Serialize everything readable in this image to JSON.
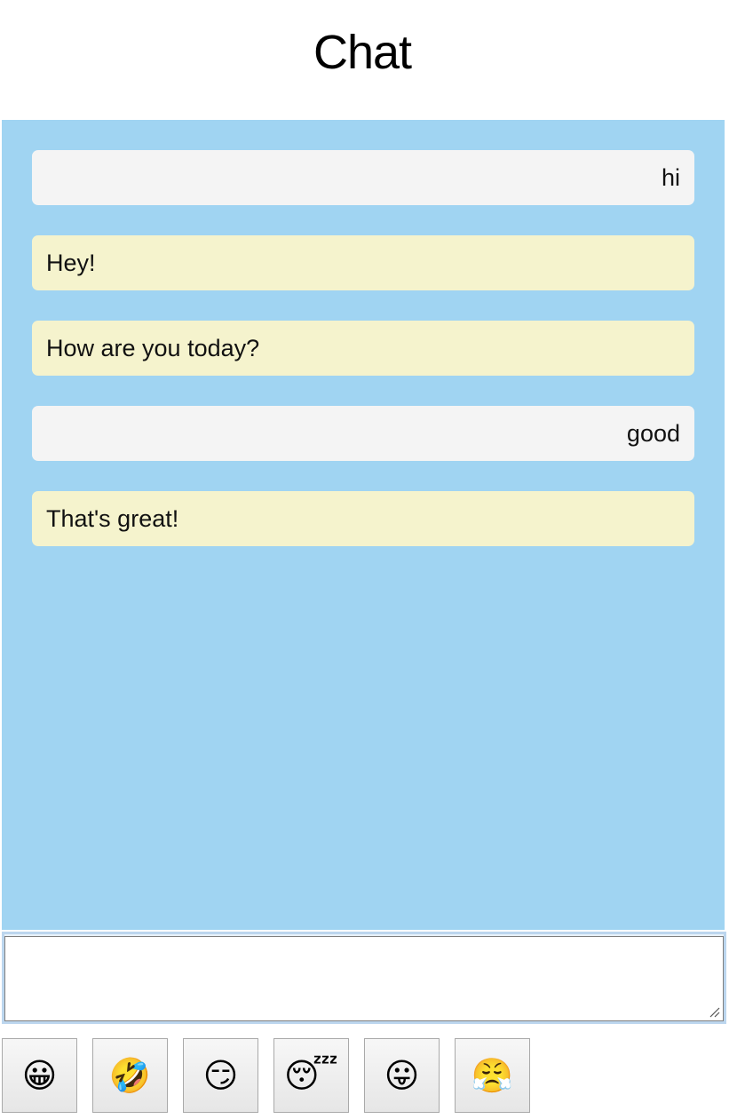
{
  "header": {
    "title": "Chat"
  },
  "messages": [
    {
      "sender": "user",
      "text": "hi"
    },
    {
      "sender": "bot",
      "text": "Hey!"
    },
    {
      "sender": "bot",
      "text": "How are you today?"
    },
    {
      "sender": "user",
      "text": "good"
    },
    {
      "sender": "bot",
      "text": "That's great!"
    }
  ],
  "composer": {
    "value": "",
    "placeholder": ""
  },
  "emoji_buttons": [
    {
      "name": "grinning-face",
      "glyph": "😀"
    },
    {
      "name": "rolling-on-floor-laughing",
      "glyph": "🤣"
    },
    {
      "name": "smirking-face",
      "glyph": "😏"
    },
    {
      "name": "sleeping-face",
      "glyph": "😴"
    },
    {
      "name": "face-with-tongue",
      "glyph": "😛"
    },
    {
      "name": "face-with-steam-from-nose",
      "glyph": "😤"
    }
  ],
  "colors": {
    "chat_background": "#a0d4f2",
    "user_bubble": "#f4f4f4",
    "bot_bubble": "#f5f3cd"
  }
}
